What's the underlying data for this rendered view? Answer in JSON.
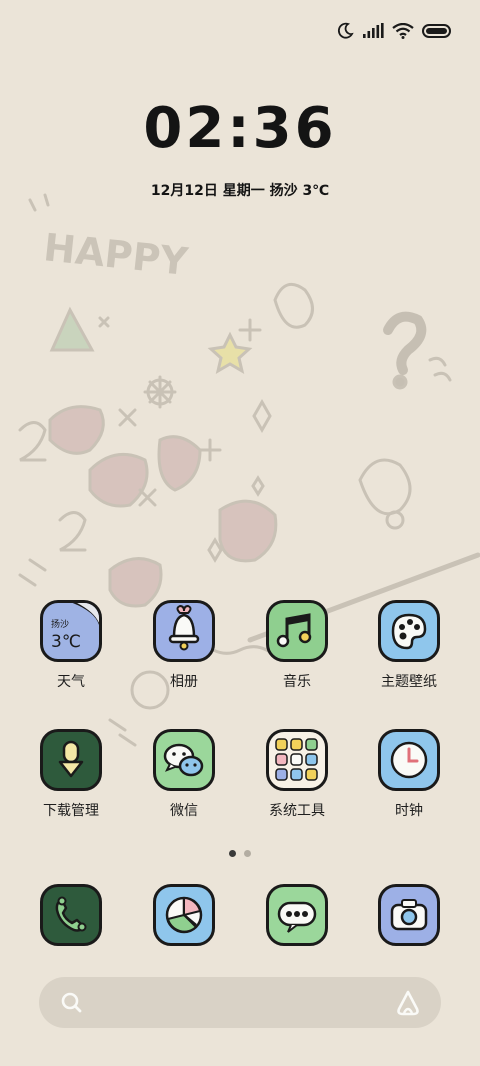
{
  "status_bar": {
    "icons": [
      "moon-icon",
      "signal-icon",
      "wifi-icon",
      "battery-icon"
    ]
  },
  "lockclock": {
    "time": "02:36",
    "date": "12月12日 星期一 扬沙 3℃"
  },
  "wallpaper": {
    "text": "HAPPY"
  },
  "apps": [
    {
      "label": "天气",
      "icon": "weather-icon",
      "color": "#9fb3e4"
    },
    {
      "label": "相册",
      "icon": "gallery-bell-icon",
      "color": "#9db0e6"
    },
    {
      "label": "音乐",
      "icon": "music-icon",
      "color": "#8fcf8f"
    },
    {
      "label": "主题壁纸",
      "icon": "theme-palette-icon",
      "color": "#8fc6ec"
    },
    {
      "label": "下载管理",
      "icon": "download-icon",
      "color": "#2e5a3c"
    },
    {
      "label": "微信",
      "icon": "wechat-icon",
      "color": "#9bd79b"
    },
    {
      "label": "系统工具",
      "icon": "system-tools-icon",
      "color": "#f7f1e6"
    },
    {
      "label": "时钟",
      "icon": "clock-icon",
      "color": "#8fc6ec"
    }
  ],
  "weather_widget": {
    "city": "扬沙",
    "temp": "3℃"
  },
  "page_indicator": {
    "count": 2,
    "active": 1
  },
  "dock": [
    {
      "icon": "phone-icon",
      "color": "#2e5a3c"
    },
    {
      "icon": "browser-icon",
      "color": "#8fc6ec"
    },
    {
      "icon": "messages-icon",
      "color": "#9bd79b"
    },
    {
      "icon": "camera-icon",
      "color": "#9db0e6"
    }
  ],
  "search_bar": {
    "icons": [
      "search-icon",
      "assistant-icon"
    ]
  }
}
